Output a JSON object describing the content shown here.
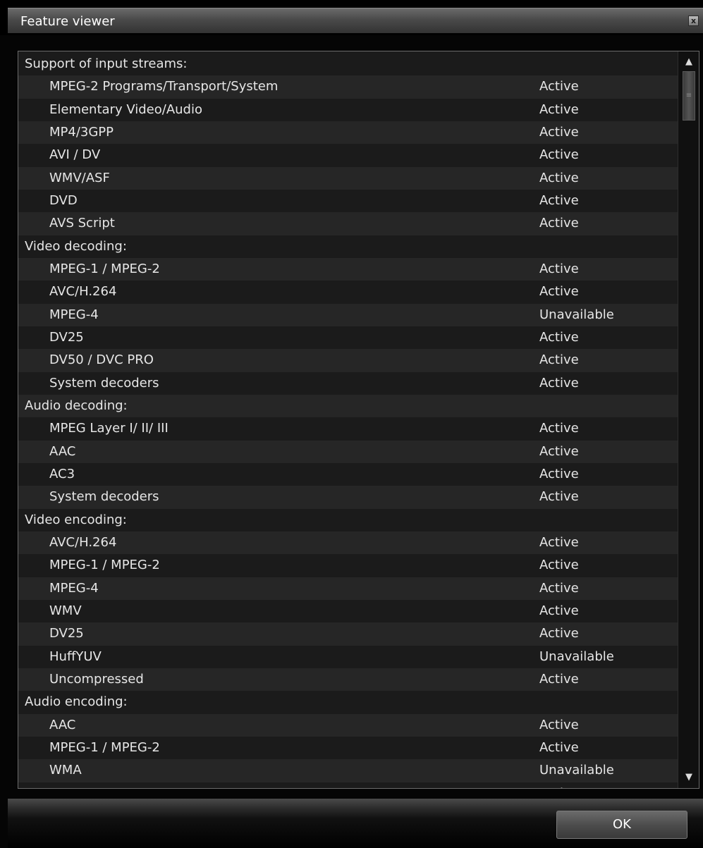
{
  "window": {
    "title": "Feature viewer",
    "close_label": "x"
  },
  "features": {
    "rows": [
      {
        "kind": "section",
        "name": "Support of input streams:",
        "status": ""
      },
      {
        "kind": "item",
        "name": "MPEG-2 Programs/Transport/System",
        "status": "Active"
      },
      {
        "kind": "item",
        "name": "Elementary Video/Audio",
        "status": "Active"
      },
      {
        "kind": "item",
        "name": "MP4/3GPP",
        "status": "Active"
      },
      {
        "kind": "item",
        "name": "AVI / DV",
        "status": "Active"
      },
      {
        "kind": "item",
        "name": "WMV/ASF",
        "status": "Active"
      },
      {
        "kind": "item",
        "name": "DVD",
        "status": "Active"
      },
      {
        "kind": "item",
        "name": "AVS Script",
        "status": "Active"
      },
      {
        "kind": "section",
        "name": "Video decoding:",
        "status": ""
      },
      {
        "kind": "item",
        "name": "MPEG-1 / MPEG-2",
        "status": "Active"
      },
      {
        "kind": "item",
        "name": "AVC/H.264",
        "status": "Active"
      },
      {
        "kind": "item",
        "name": "MPEG-4",
        "status": "Unavailable"
      },
      {
        "kind": "item",
        "name": "DV25",
        "status": "Active"
      },
      {
        "kind": "item",
        "name": "DV50 / DVC PRO",
        "status": "Active"
      },
      {
        "kind": "item",
        "name": "System decoders",
        "status": "Active"
      },
      {
        "kind": "section",
        "name": "Audio decoding:",
        "status": ""
      },
      {
        "kind": "item",
        "name": "MPEG Layer I/ II/ III",
        "status": "Active"
      },
      {
        "kind": "item",
        "name": "AAC",
        "status": "Active"
      },
      {
        "kind": "item",
        "name": "AC3",
        "status": "Active"
      },
      {
        "kind": "item",
        "name": "System decoders",
        "status": "Active"
      },
      {
        "kind": "section",
        "name": "Video encoding:",
        "status": ""
      },
      {
        "kind": "item",
        "name": "AVC/H.264",
        "status": "Active"
      },
      {
        "kind": "item",
        "name": "MPEG-1 / MPEG-2",
        "status": "Active"
      },
      {
        "kind": "item",
        "name": "MPEG-4",
        "status": "Active"
      },
      {
        "kind": "item",
        "name": "WMV",
        "status": "Active"
      },
      {
        "kind": "item",
        "name": "DV25",
        "status": "Active"
      },
      {
        "kind": "item",
        "name": "HuffYUV",
        "status": "Unavailable"
      },
      {
        "kind": "item",
        "name": "Uncompressed",
        "status": "Active"
      },
      {
        "kind": "section",
        "name": "Audio encoding:",
        "status": ""
      },
      {
        "kind": "item",
        "name": "AAC",
        "status": "Active"
      },
      {
        "kind": "item",
        "name": "MPEG-1 / MPEG-2",
        "status": "Active"
      },
      {
        "kind": "item",
        "name": "WMA",
        "status": "Unavailable"
      },
      {
        "kind": "item",
        "name": "PCM",
        "status": "Active"
      }
    ]
  },
  "scrollbar": {
    "up_icon": "triangle-up-icon",
    "down_icon": "triangle-down-icon",
    "thumb_grip_icon": "grip-lines-icon"
  },
  "footer": {
    "ok_label": "OK"
  }
}
